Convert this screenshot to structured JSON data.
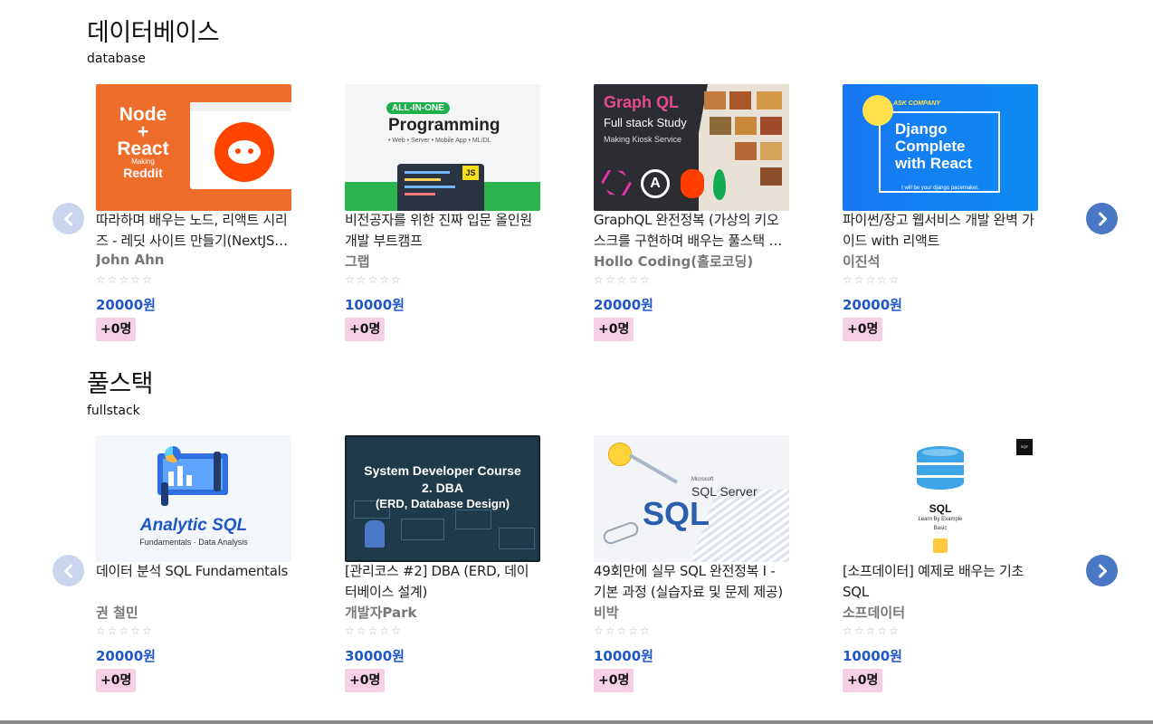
{
  "sections": [
    {
      "title": "데이터베이스",
      "subtitle": "database",
      "cards": [
        {
          "title": "따라하며 배우는 노드, 리액트 시리즈 - 레딧 사이트 만들기(NextJS)(Pages Router)",
          "author": "John Ahn",
          "stars": "☆☆☆☆☆",
          "price": "20000원",
          "count": "+0명",
          "thumb": {
            "line1": "Node",
            "line2": "+",
            "line3": "React",
            "small": "Making",
            "brand": "Reddit"
          }
        },
        {
          "title": "비전공자를 위한 진짜 입문 올인원 개발 부트캠프",
          "author": "그랩",
          "stars": "☆☆☆☆☆",
          "price": "10000원",
          "count": "+0명",
          "thumb": {
            "badge": "ALL-IN-ONE",
            "heading": "Programming",
            "tags": "• Web • Server • Mobile App • ML/DL",
            "js": "JS"
          }
        },
        {
          "title": "GraphQL 완전정복 (가상의 키오스크를 구현하며 배우는 풀스택 과정)",
          "author": "Hollo Coding(홀로코딩)",
          "stars": "☆☆☆☆☆",
          "price": "20000원",
          "count": "+0명",
          "thumb": {
            "heading": "Graph QL",
            "line1": "Full stack Study",
            "line2": "Making Kiosk Service"
          }
        },
        {
          "title": "파이썬/장고 웹서비스 개발 완벽 가이드 with 리액트",
          "author": "이진석",
          "stars": "☆☆☆☆☆",
          "price": "20000원",
          "count": "+0명",
          "thumb": {
            "badge": "ASK COMPANY",
            "line1": "Django",
            "line2": "Complete",
            "line3": "with React",
            "foot": "I will be your django pacemaker."
          }
        }
      ]
    },
    {
      "title": "풀스택",
      "subtitle": "fullstack",
      "cards": [
        {
          "title": "데이터 분석 SQL Fundamentals",
          "author": "권 철민",
          "stars": "☆☆☆☆☆",
          "price": "20000원",
          "count": "+0명",
          "thumb": {
            "heading": "Analytic SQL",
            "sub": "Fundamentals · Data Analysis"
          }
        },
        {
          "title": "[관리코스 #2] DBA (ERD, 데이터베이스 설계)",
          "author": "개발자Park",
          "stars": "☆☆☆☆☆",
          "price": "30000원",
          "count": "+0명",
          "thumb": {
            "line1": "System Developer Course",
            "line2": "2. DBA",
            "line3": "(ERD, Database Design)"
          }
        },
        {
          "title": "49회만에 실무 SQL 완전정복 I - 기본 과정 (실습자료 및 문제 제공)",
          "author": "비박",
          "stars": "☆☆☆☆☆",
          "price": "10000원",
          "count": "+0명",
          "thumb": {
            "small": "Microsoft",
            "product": "SQL Server",
            "big": "SQL"
          }
        },
        {
          "title": "[소프데이터] 예제로 배우는 기초 SQL",
          "author": "소프데이터",
          "stars": "☆☆☆☆☆",
          "price": "10000원",
          "count": "+0명",
          "thumb": {
            "heading": "SQL",
            "line1": "Learn By Example",
            "line2": "Basic",
            "corner": "SQF"
          }
        }
      ]
    }
  ],
  "colors": {
    "price": "#1f58c6",
    "count_bg": "#f5cfe3",
    "arrow_prev": "#c9d6ee",
    "arrow_next": "#4a78c5"
  }
}
